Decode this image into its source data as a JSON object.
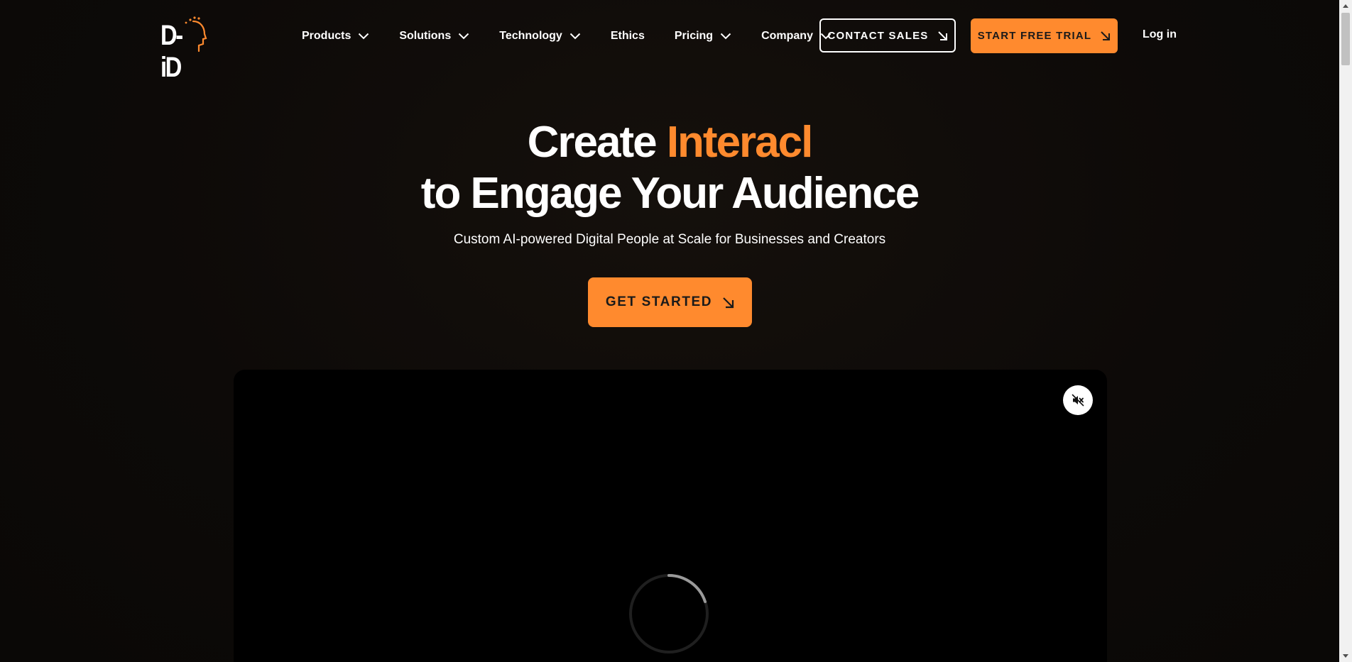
{
  "brand": {
    "logo_text": "D-iD",
    "accent_color": "#ff8a2e",
    "background_color": "#0d0a08"
  },
  "nav": {
    "items": [
      {
        "label": "Products",
        "has_dropdown": true
      },
      {
        "label": "Solutions",
        "has_dropdown": true
      },
      {
        "label": "Technology",
        "has_dropdown": true
      },
      {
        "label": "Ethics",
        "has_dropdown": false
      },
      {
        "label": "Pricing",
        "has_dropdown": true
      },
      {
        "label": "Company",
        "has_dropdown": true
      }
    ],
    "contact_sales_label": "CONTACT SALES",
    "start_trial_label": "START FREE TRIAL",
    "login_label": "Log in"
  },
  "hero": {
    "title_prefix": "Create ",
    "title_accent": "Interacl",
    "title_line2": "to Engage Your Audience",
    "subtitle": "Custom AI-powered Digital People at Scale for Businesses and Creators",
    "cta_label": "GET STARTED"
  },
  "video": {
    "mute_icon": "speaker-muted-icon",
    "loading_icon": "loading-spinner-icon"
  },
  "icons": {
    "dropdown": "chevron-down-icon",
    "cta_arrow": "arrow-down-right-icon"
  }
}
